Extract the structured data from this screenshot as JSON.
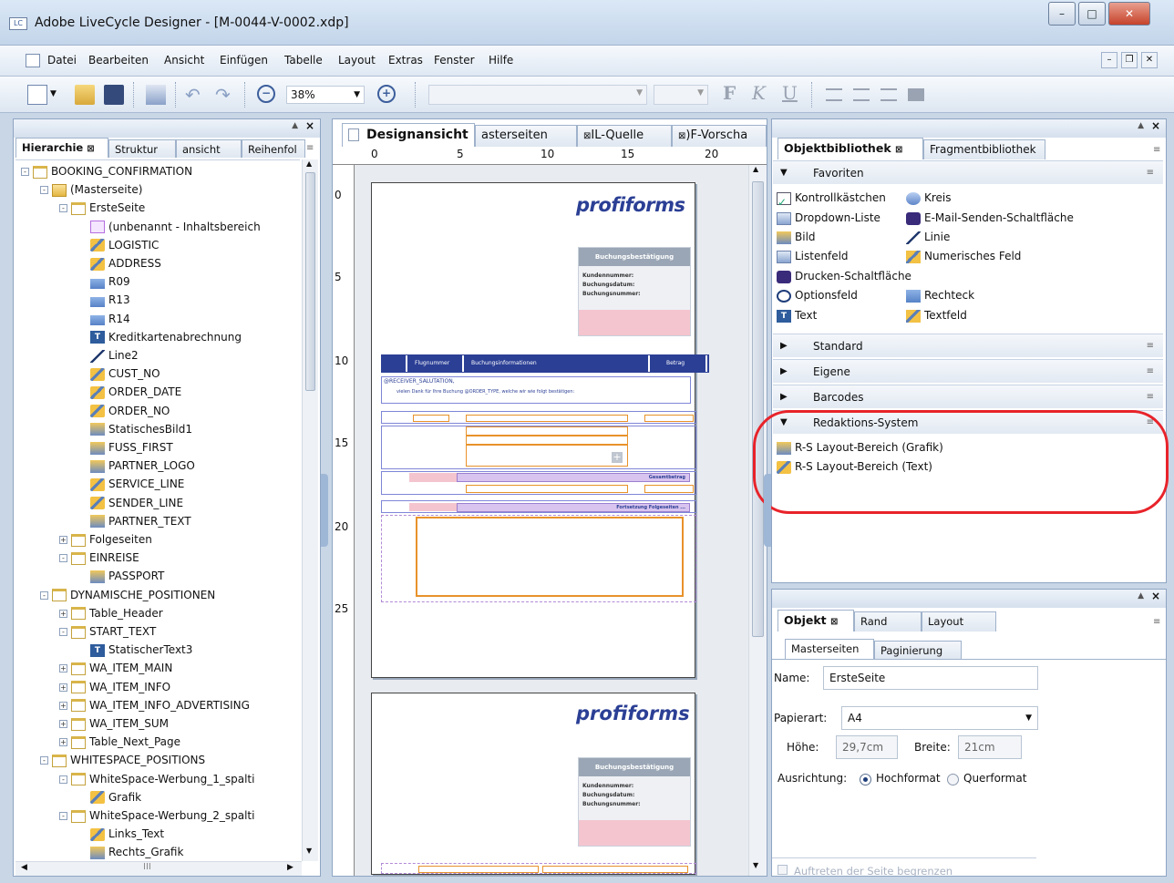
{
  "window": {
    "title": "Adobe LiveCycle Designer - [M-0044-V-0002.xdp]",
    "app_icon": "LC",
    "buttons": [
      "–",
      "□",
      "✕"
    ]
  },
  "menu": [
    "Datei",
    "Bearbeiten",
    "Ansicht",
    "Einfügen",
    "Tabelle",
    "Layout",
    "Extras",
    "Fenster",
    "Hilfe"
  ],
  "toolbar": {
    "zoom": "38%",
    "bold": "F",
    "italic": "K",
    "underline": "U"
  },
  "left_panel": {
    "tabs": [
      "Hierarchie",
      "Struktur",
      "ansicht",
      "Reihenfol"
    ],
    "tree": [
      {
        "label": "BOOKING_CONFIRMATION",
        "depth": 0,
        "icon": "page-icon",
        "exp": "-"
      },
      {
        "label": "(Masterseite)",
        "depth": 1,
        "icon": "folder-icon",
        "exp": "-"
      },
      {
        "label": "ErsteSeite",
        "depth": 2,
        "icon": "page-icon",
        "exp": "-"
      },
      {
        "label": "(unbenannt - Inhaltsbereich",
        "depth": 3,
        "icon": "content-area-icon"
      },
      {
        "label": "LOGISTIC",
        "depth": 3,
        "icon": "textfield-icon"
      },
      {
        "label": "ADDRESS",
        "depth": 3,
        "icon": "textfield-icon"
      },
      {
        "label": "R09",
        "depth": 3,
        "icon": "rectangle-icon"
      },
      {
        "label": "R13",
        "depth": 3,
        "icon": "rectangle-icon"
      },
      {
        "label": "R14",
        "depth": 3,
        "icon": "rectangle-icon"
      },
      {
        "label": "Kreditkartenabrechnung",
        "depth": 3,
        "icon": "text-icon"
      },
      {
        "label": "Line2",
        "depth": 3,
        "icon": "line-icon"
      },
      {
        "label": "CUST_NO",
        "depth": 3,
        "icon": "textfield-icon"
      },
      {
        "label": "ORDER_DATE",
        "depth": 3,
        "icon": "textfield-icon"
      },
      {
        "label": "ORDER_NO",
        "depth": 3,
        "icon": "textfield-icon"
      },
      {
        "label": "StatischesBild1",
        "depth": 3,
        "icon": "image-icon"
      },
      {
        "label": "FUSS_FIRST",
        "depth": 3,
        "icon": "image-field-icon"
      },
      {
        "label": "PARTNER_LOGO",
        "depth": 3,
        "icon": "image-field-icon"
      },
      {
        "label": "SERVICE_LINE",
        "depth": 3,
        "icon": "textfield-icon"
      },
      {
        "label": "SENDER_LINE",
        "depth": 3,
        "icon": "textfield-icon"
      },
      {
        "label": "PARTNER_TEXT",
        "depth": 3,
        "icon": "image-field-icon"
      },
      {
        "label": "Folgeseiten",
        "depth": 2,
        "icon": "page-icon",
        "exp": "+"
      },
      {
        "label": "EINREISE",
        "depth": 2,
        "icon": "page-icon",
        "exp": "-"
      },
      {
        "label": "PASSPORT",
        "depth": 3,
        "icon": "image-field-icon"
      },
      {
        "label": "DYNAMISCHE_POSITIONEN",
        "depth": 1,
        "icon": "subform-icon",
        "exp": "-"
      },
      {
        "label": "Table_Header",
        "depth": 2,
        "icon": "subform-icon",
        "exp": "+"
      },
      {
        "label": "START_TEXT",
        "depth": 2,
        "icon": "subform-icon",
        "exp": "-"
      },
      {
        "label": "StatischerText3",
        "depth": 3,
        "icon": "text-icon"
      },
      {
        "label": "WA_ITEM_MAIN",
        "depth": 2,
        "icon": "subform-icon",
        "exp": "+"
      },
      {
        "label": "WA_ITEM_INFO",
        "depth": 2,
        "icon": "subform-icon",
        "exp": "+"
      },
      {
        "label": "WA_ITEM_INFO_ADVERTISING",
        "depth": 2,
        "icon": "subform-icon",
        "exp": "+"
      },
      {
        "label": "WA_ITEM_SUM",
        "depth": 2,
        "icon": "subform-icon",
        "exp": "+"
      },
      {
        "label": "Table_Next_Page",
        "depth": 2,
        "icon": "subform-icon",
        "exp": "+"
      },
      {
        "label": "WHITESPACE_POSITIONS",
        "depth": 1,
        "icon": "subform-icon",
        "exp": "-"
      },
      {
        "label": "WhiteSpace-Werbung_1_spalti",
        "depth": 2,
        "icon": "subform-icon",
        "exp": "-"
      },
      {
        "label": "Grafik",
        "depth": 3,
        "icon": "textfield-icon"
      },
      {
        "label": "WhiteSpace-Werbung_2_spalti",
        "depth": 2,
        "icon": "subform-icon",
        "exp": "-"
      },
      {
        "label": "Links_Text",
        "depth": 3,
        "icon": "textfield-icon"
      },
      {
        "label": "Rechts_Grafik",
        "depth": 3,
        "icon": "image-field-icon"
      }
    ],
    "scroll_label": "III"
  },
  "center": {
    "tabs": [
      "Designansicht",
      "asterseiten",
      "IL-Quelle",
      ")F-Vorscha"
    ],
    "ruler_h": [
      "0",
      "5",
      "10",
      "15",
      "20"
    ],
    "ruler_v": [
      "0",
      "5",
      "10",
      "15",
      "20",
      "25"
    ],
    "logo": "profiforms",
    "box_title": "Buchungsbestätigung",
    "box_lines": [
      "Kundennummer:",
      "Buchungsdatum:",
      "Buchungsnummer:"
    ],
    "table_head": [
      "Flugnummer",
      "Buchungsinformationen",
      "Betrag"
    ],
    "salutation": "@RECEIVER_SALUTATION,",
    "thanks": "vielen Dank für Ihre Buchung @ORDER_TYPE, welche wir wie folgt bestätigen:",
    "gesamt": "Gesamtbetrag",
    "fortsetzung": "Fortsetzung Folgeseiten ..."
  },
  "right_top": {
    "tabs": [
      "Objektbibliothek",
      "Fragmentbibliothek"
    ],
    "sections": {
      "favoriten": "Favoriten",
      "standard": "Standard",
      "eigene": "Eigene",
      "barcodes": "Barcodes",
      "redaktion": "Redaktions-System"
    },
    "favorites": [
      {
        "label": "Kontrollkästchen",
        "icon": "checkbox-icon"
      },
      {
        "label": "Kreis",
        "icon": "circle-icon"
      },
      {
        "label": "Dropdown-Liste",
        "icon": "dropdown-icon"
      },
      {
        "label": "E-Mail-Senden-Schaltfläche",
        "icon": "email-button-icon"
      },
      {
        "label": "Bild",
        "icon": "image-icon"
      },
      {
        "label": "Linie",
        "icon": "line-icon"
      },
      {
        "label": "Listenfeld",
        "icon": "listbox-icon"
      },
      {
        "label": "Numerisches Feld",
        "icon": "numeric-field-icon"
      },
      {
        "label": "Drucken-Schaltfläche",
        "icon": "print-button-icon"
      },
      {
        "label": "Optionsfeld",
        "icon": "radio-icon"
      },
      {
        "label": "Rechteck",
        "icon": "rectangle-icon"
      },
      {
        "label": "Text",
        "icon": "text-icon"
      },
      {
        "label": "Textfeld",
        "icon": "textfield-icon"
      }
    ],
    "redaktion_items": [
      "R-S Layout-Bereich (Grafik)",
      "R-S Layout-Bereich (Text)"
    ]
  },
  "right_bottom": {
    "tabs": [
      "Objekt",
      "Rand",
      "Layout"
    ],
    "subtabs": [
      "Masterseiten",
      "Paginierung"
    ],
    "name_label": "Name:",
    "name_value": "ErsteSeite",
    "paper_label": "Papierart:",
    "paper_value": "A4",
    "height_label": "Höhe:",
    "height_value": "29,7cm",
    "width_label": "Breite:",
    "width_value": "21cm",
    "orient_label": "Ausrichtung:",
    "orient_portrait": "Hochformat",
    "orient_landscape": "Querformat",
    "limit_label": "Auftreten der Seite begrenzen"
  },
  "colors": {
    "highlight": "#e8232a",
    "accent": "#2b3f95",
    "orange": "#e8922a",
    "pink": "#f4c5cf",
    "lilac": "#d8c4ef"
  }
}
